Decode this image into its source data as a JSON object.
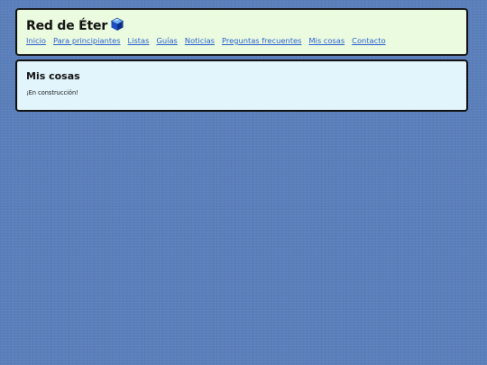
{
  "site": {
    "title": "Red de Éter",
    "logo_icon": "blue-cube-icon"
  },
  "nav": {
    "items": [
      "Inicio",
      "Para principiantes",
      "Listas",
      "Guías",
      "Noticias",
      "Preguntas frecuentes",
      "Mis cosas",
      "Contacto"
    ]
  },
  "main": {
    "title": "Mis cosas",
    "text": "¡En construcción!"
  },
  "colors": {
    "background": "#5a7fbb",
    "header_panel": "#ebfbdf",
    "content_panel": "#e2f5fc",
    "link": "#2a5fcf"
  }
}
